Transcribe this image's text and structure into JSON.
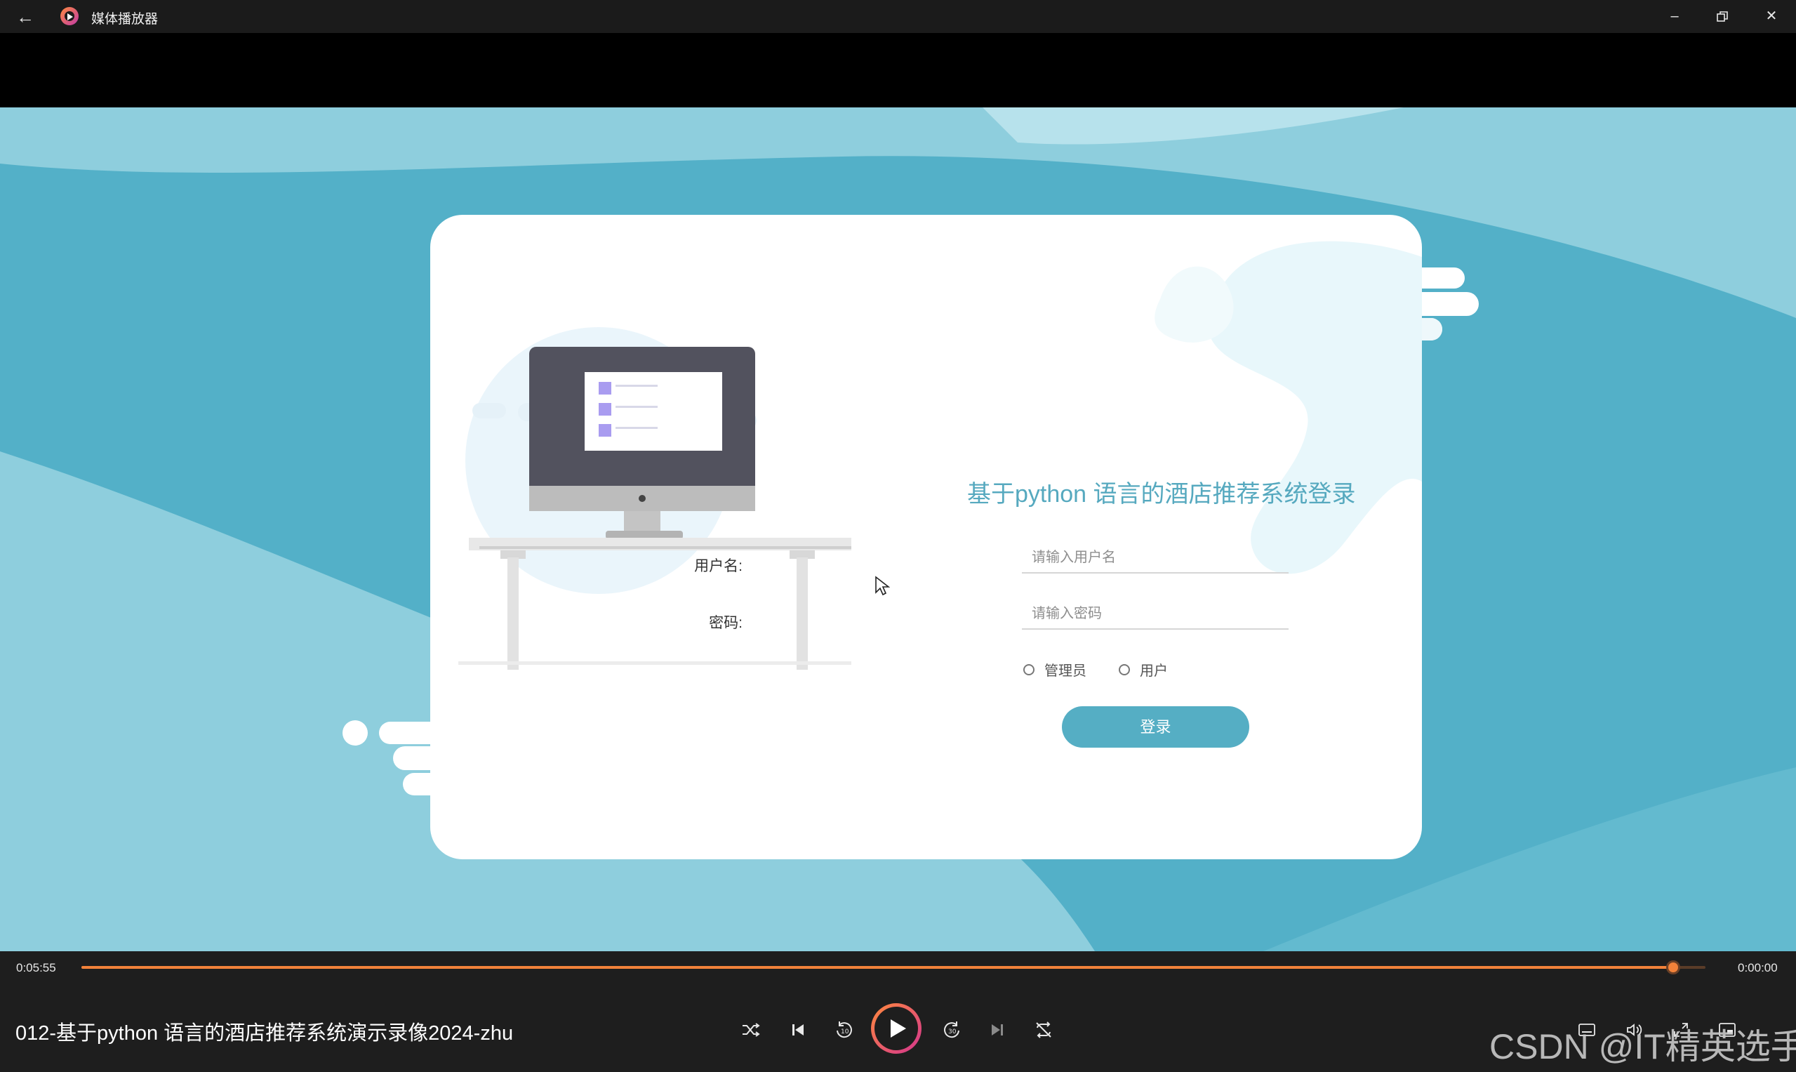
{
  "app": {
    "title": "媒体播放器",
    "icons": {
      "back": "back-arrow-icon",
      "app": "media-player-icon",
      "minimize": "minimize-icon",
      "maximize": "restore-icon",
      "close": "close-icon"
    }
  },
  "login": {
    "title": "基于python 语言的酒店推荐系统登录",
    "username_label": "用户名:",
    "username_placeholder": "请输入用户名",
    "password_label": "密码:",
    "password_placeholder": "请输入密码",
    "role_admin": "管理员",
    "role_user": "用户",
    "submit_label": "登录",
    "accent": "#55aec4"
  },
  "player": {
    "elapsed": "0:05:55",
    "remaining": "0:00:00",
    "progress": 0.98,
    "media_title": "012-基于python 语言的酒店推荐系统演示录像2024-zhu",
    "accent": "#f2823a"
  },
  "watermark": "CSDN @IT精英选手"
}
